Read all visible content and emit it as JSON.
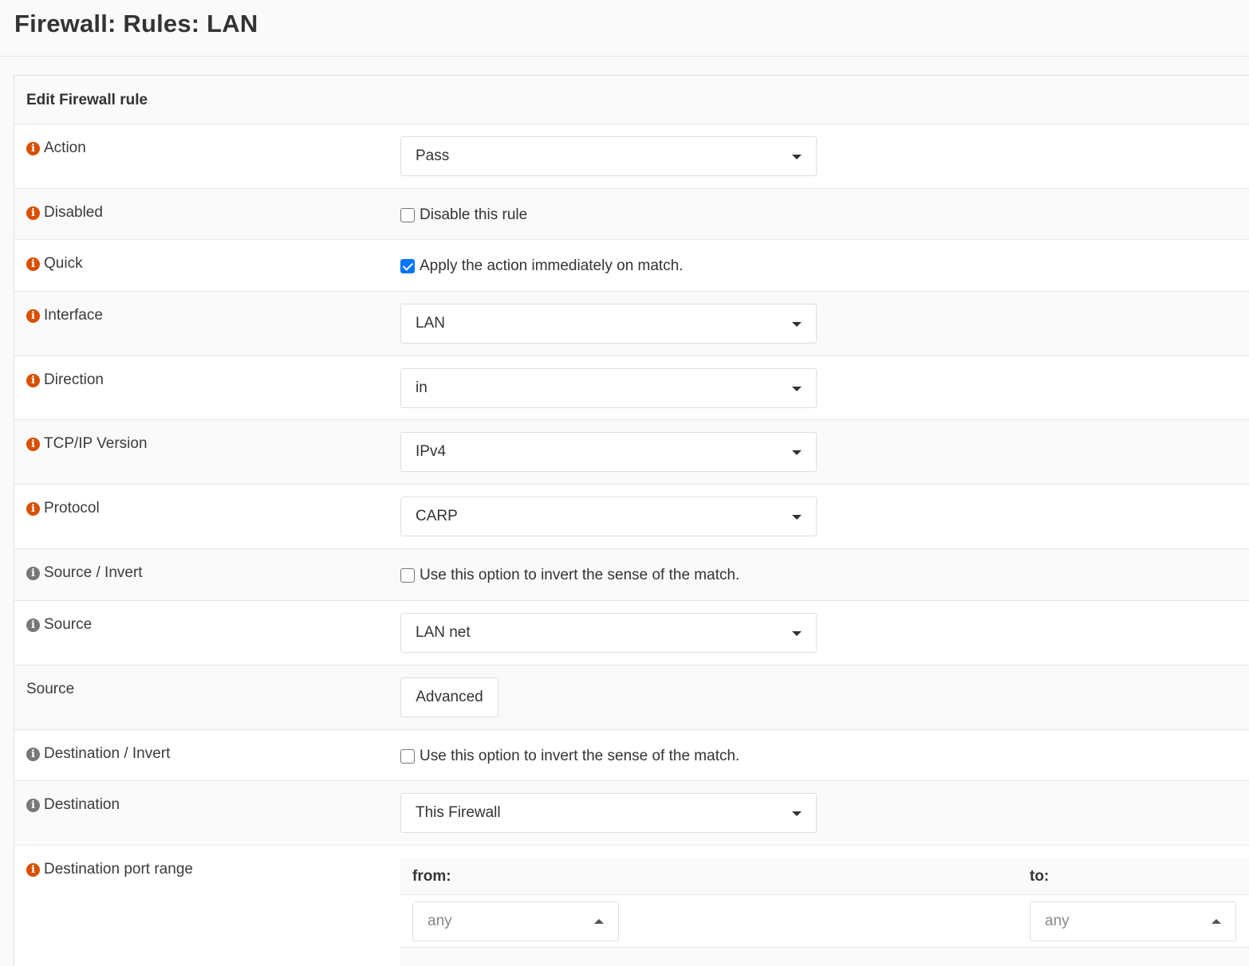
{
  "page": {
    "title": "Firewall: Rules: LAN"
  },
  "panel": {
    "heading": "Edit Firewall rule"
  },
  "fields": {
    "action": {
      "label": "Action",
      "value": "Pass"
    },
    "disabled": {
      "label": "Disabled",
      "checkbox_label": "Disable this rule",
      "checked": false
    },
    "quick": {
      "label": "Quick",
      "checkbox_label": "Apply the action immediately on match.",
      "checked": true
    },
    "interface": {
      "label": "Interface",
      "value": "LAN"
    },
    "direction": {
      "label": "Direction",
      "value": "in"
    },
    "tcpip_version": {
      "label": "TCP/IP Version",
      "value": "IPv4"
    },
    "protocol": {
      "label": "Protocol",
      "value": "CARP"
    },
    "source_invert": {
      "label": "Source / Invert",
      "checkbox_label": "Use this option to invert the sense of the match.",
      "checked": false
    },
    "source": {
      "label": "Source",
      "value": "LAN net"
    },
    "source_advanced": {
      "label": "Source",
      "button_label": "Advanced"
    },
    "destination_invert": {
      "label": "Destination / Invert",
      "checkbox_label": "Use this option to invert the sense of the match.",
      "checked": false
    },
    "destination": {
      "label": "Destination",
      "value": "This Firewall"
    },
    "destination_port_range": {
      "label": "Destination port range",
      "from_label": "from:",
      "to_label": "to:",
      "from_value": "any",
      "to_value": "any"
    }
  },
  "icons": {
    "info_orange": "info-circle-icon",
    "info_gray": "info-circle-icon"
  },
  "colors": {
    "info_orange": "#d94f00",
    "info_gray": "#777777",
    "checkbox_checked": "#0075ff"
  }
}
